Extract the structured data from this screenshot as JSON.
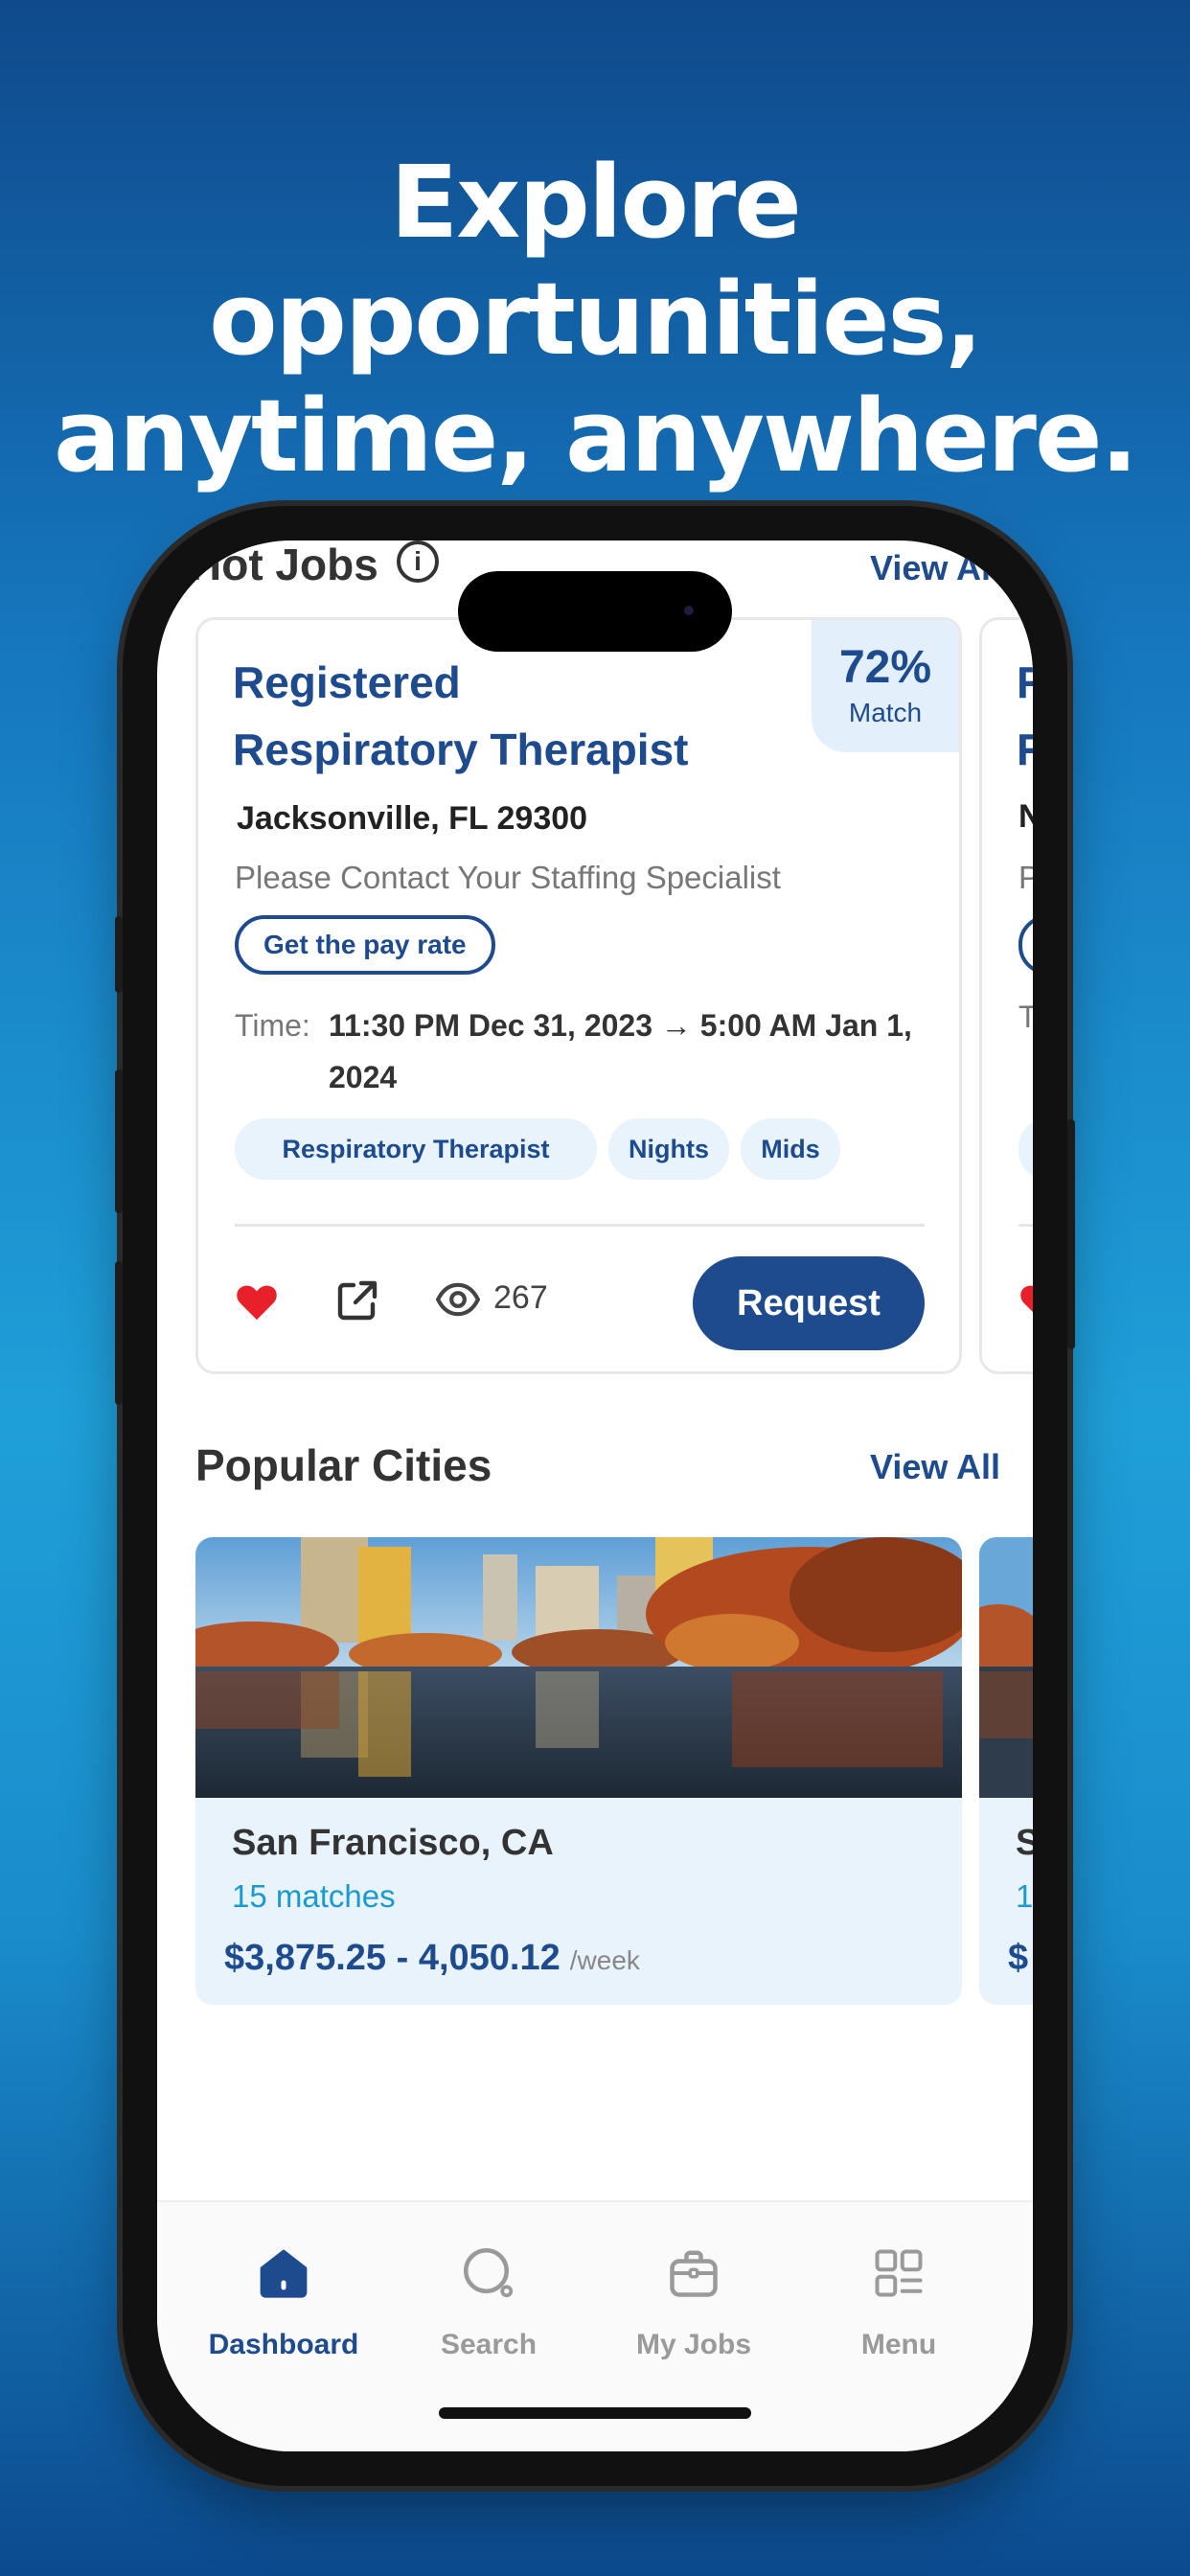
{
  "headline": {
    "line1": "Explore opportunities,",
    "line2": "anytime, anywhere."
  },
  "hot_jobs": {
    "title": "Hot Jobs",
    "view_all": "View All",
    "card": {
      "title_line1": "Registered",
      "title_line2": "Respiratory Therapist",
      "match_pct": "72%",
      "match_label": "Match",
      "location": "Jacksonville, FL 29300",
      "contact": "Please Contact Your Staffing Specialist",
      "pay_button": "Get the pay rate",
      "time_label": "Time:",
      "time_value": "11:30 PM Dec 31, 2023 → 5:00 AM Jan 1, 2024",
      "tags": [
        "Respiratory Therapist",
        "Nights",
        "Mids"
      ],
      "views": "267",
      "request_button": "Request"
    },
    "peek_card": {
      "title_line1": "R",
      "title_line2": "R",
      "location": "N",
      "contact": "P",
      "time_label": "T"
    }
  },
  "popular_cities": {
    "title": "Popular Cities",
    "view_all": "View All",
    "card": {
      "city": "San Francisco, CA",
      "matches": "15 matches",
      "price": "$3,875.25 - 4,050.12",
      "unit": "/week"
    },
    "peek_card": {
      "city": "S",
      "matches": "1",
      "price": "$"
    }
  },
  "tabbar": {
    "items": [
      {
        "label": "Dashboard",
        "icon": "home-icon",
        "active": true
      },
      {
        "label": "Search",
        "icon": "search-icon",
        "active": false
      },
      {
        "label": "My Jobs",
        "icon": "briefcase-icon",
        "active": false
      },
      {
        "label": "Menu",
        "icon": "grid-menu-icon",
        "active": false
      }
    ]
  },
  "colors": {
    "brand": "#1e4a8e",
    "accent": "#1b9ad0",
    "heart": "#e8202a",
    "tag_bg": "#e8f3fc"
  }
}
